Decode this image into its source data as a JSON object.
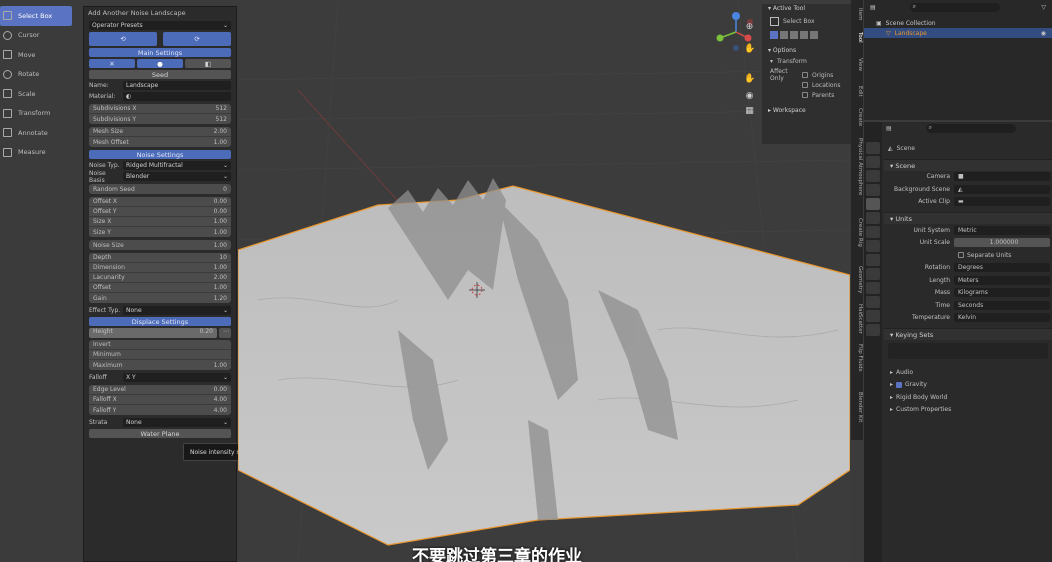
{
  "toolbar": {
    "items": [
      {
        "label": "Select Box",
        "icon": "select-box-icon"
      },
      {
        "label": "Cursor",
        "icon": "cursor-icon"
      },
      {
        "label": "Move",
        "icon": "move-icon"
      },
      {
        "label": "Rotate",
        "icon": "rotate-icon"
      },
      {
        "label": "Scale",
        "icon": "scale-icon"
      },
      {
        "label": "Transform",
        "icon": "transform-icon"
      },
      {
        "label": "Annotate",
        "icon": "annotate-icon"
      },
      {
        "label": "Measure",
        "icon": "measure-icon"
      }
    ]
  },
  "operator": {
    "title": "Add Another Noise Landscape",
    "presets_label": "Operator Presets",
    "main_settings": "Main Settings",
    "seed_label": "Seed",
    "refresh_label": "Refresh",
    "name_label": "Name:",
    "name_value": "Landscape",
    "material_label": "Material:",
    "subdiv_x": {
      "label": "Subdivisions X",
      "value": "512"
    },
    "subdiv_y": {
      "label": "Subdivisions Y",
      "value": "512"
    },
    "mesh_size": {
      "label": "Mesh Size",
      "value": "2.00"
    },
    "mesh_offset": {
      "label": "Mesh Offset",
      "value": "1.00"
    },
    "noise_settings": "Noise Settings",
    "noise_type_label": "Noise Typ.",
    "noise_type_value": "Ridged Multifractal",
    "noise_basis_label": "Noise Basis",
    "noise_basis_value": "Blender",
    "random_seed": {
      "label": "Random Seed",
      "value": "0"
    },
    "offsets": [
      {
        "label": "Offset X",
        "value": "0.00"
      },
      {
        "label": "Offset Y",
        "value": "0.00"
      },
      {
        "label": "Size X",
        "value": "1.00"
      },
      {
        "label": "Size Y",
        "value": "1.00"
      }
    ],
    "noise_size": {
      "label": "Noise Size",
      "value": "1.00"
    },
    "params": [
      {
        "label": "Depth",
        "value": "10"
      },
      {
        "label": "Dimension",
        "value": "1.00"
      },
      {
        "label": "Lacunarity",
        "value": "2.00"
      },
      {
        "label": "Offset",
        "value": "1.00"
      },
      {
        "label": "Gain",
        "value": "1.20"
      }
    ],
    "effect_type_label": "Effect Typ.",
    "effect_type_value": "None",
    "displace_settings": "Displace Settings",
    "height": {
      "label": "Height",
      "value": "0.20"
    },
    "displace_rows": [
      {
        "label": "Invert",
        "value": ""
      },
      {
        "label": "Minimum",
        "value": ""
      },
      {
        "label": "Maximum",
        "value": "1.00"
      }
    ],
    "falloff_label": "Falloff",
    "falloff_value": "X Y",
    "edge_rows": [
      {
        "label": "Edge Level",
        "value": "0.00"
      },
      {
        "label": "Falloff X",
        "value": "4.00"
      },
      {
        "label": "Falloff Y",
        "value": "4.00"
      }
    ],
    "strata_label": "Strata",
    "strata_value": "None",
    "water_plane": "Water Plane"
  },
  "tooltip": "Noise intensity scale",
  "npanel": {
    "active_tool": "Active Tool",
    "select_box": "Select Box",
    "options": "Options",
    "transform": "Transform",
    "affect_only": "Affect Only",
    "origins": "Origins",
    "locations": "Locations",
    "parents": "Parents",
    "workspace": "Workspace"
  },
  "vtabs": [
    "Item",
    "Tool",
    "View",
    "Edit",
    "Create",
    "Physical Atmosphere",
    "Create Rig",
    "Geometry",
    "Hair",
    "Scatter",
    "Flip Fluids",
    "Blender Kit"
  ],
  "outliner": {
    "collection": "Scene Collection",
    "object": "Landscape"
  },
  "props": {
    "scene": "Scene",
    "scene_section": "Scene",
    "camera_label": "Camera",
    "bg_scene_label": "Background Scene",
    "active_clip_label": "Active Clip",
    "units_section": "Units",
    "unit_system_label": "Unit System",
    "unit_system_value": "Metric",
    "unit_scale_label": "Unit Scale",
    "unit_scale_value": "1.000000",
    "separate_units": "Separate Units",
    "rotation_label": "Rotation",
    "rotation_value": "Degrees",
    "length_label": "Length",
    "length_value": "Meters",
    "mass_label": "Mass",
    "mass_value": "Kilograms",
    "time_label": "Time",
    "time_value": "Seconds",
    "temp_label": "Temperature",
    "temp_value": "Kelvin",
    "keying_sets": "Keying Sets",
    "audio": "Audio",
    "gravity": "Gravity",
    "rigid_body": "Rigid Body World",
    "custom_props": "Custom Properties"
  },
  "subtitle": "不要跳过第三章的作业"
}
